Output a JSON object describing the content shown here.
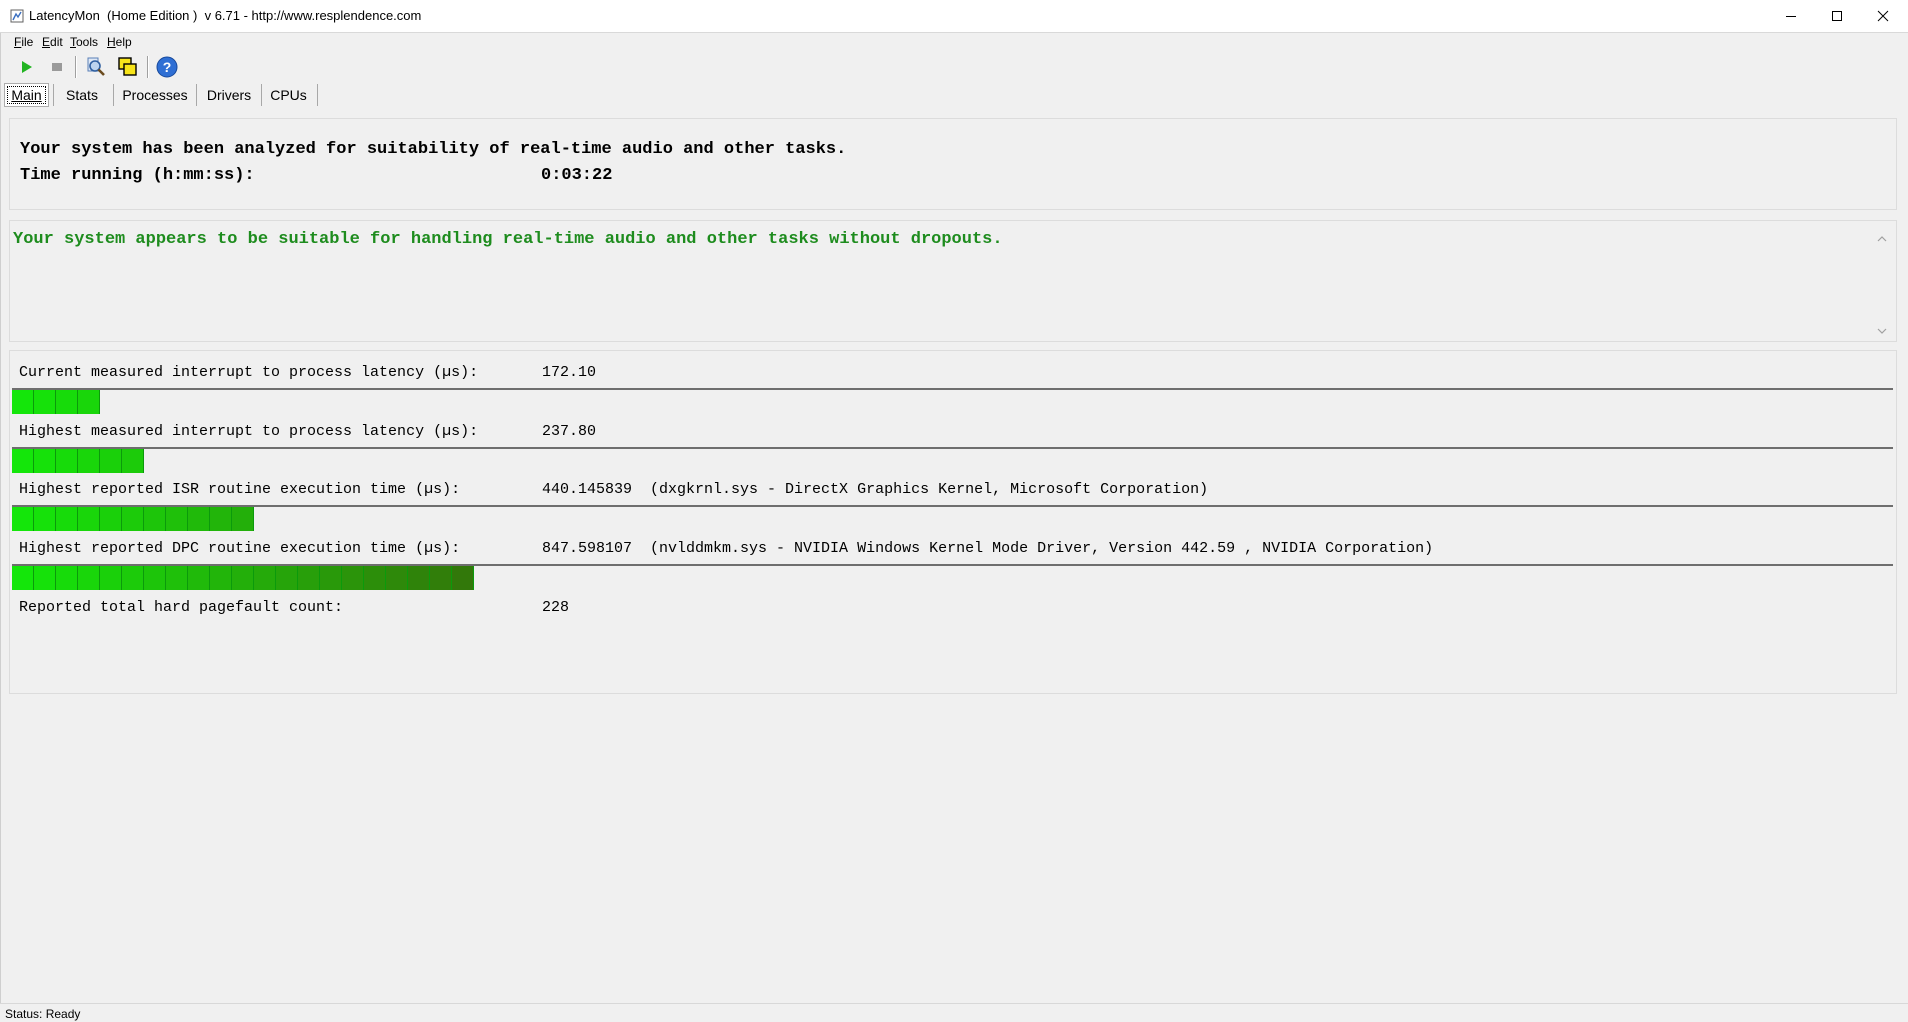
{
  "window": {
    "title": "LatencyMon  (Home Edition )  v 6.71 - http://www.resplendence.com"
  },
  "menu": [
    {
      "label": "File",
      "accel": "F",
      "rest": "ile"
    },
    {
      "label": "Edit",
      "accel": "E",
      "rest": "dit"
    },
    {
      "label": "Tools",
      "accel": "T",
      "rest": "ools"
    },
    {
      "label": "Help",
      "accel": "H",
      "rest": "elp"
    }
  ],
  "toolbar": {
    "icons": [
      "play-icon",
      "stop-icon",
      "search-drivers-icon",
      "windows-icon",
      "help-icon"
    ]
  },
  "tabs": [
    {
      "label": "Main",
      "active": true
    },
    {
      "label": "Stats",
      "active": false
    },
    {
      "label": "Processes",
      "active": false
    },
    {
      "label": "Drivers",
      "active": false
    },
    {
      "label": "CPUs",
      "active": false
    }
  ],
  "summary": {
    "analyzed_text": "Your system has been analyzed for suitability of real-time audio and other tasks.",
    "time_label": "Time running (h:mm:ss):",
    "time_value": "0:03:22"
  },
  "verdict": {
    "text": "Your system appears to be suitable for handling real-time audio and other tasks without dropouts.",
    "color": "#1e8c1e"
  },
  "metrics": [
    {
      "label": "Current measured interrupt to process latency (µs):",
      "value": "172.10",
      "detail": "",
      "bar_segments": 4
    },
    {
      "label": "Highest measured interrupt to process latency (µs):",
      "value": "237.80",
      "detail": "",
      "bar_segments": 6
    },
    {
      "label": "Highest reported ISR routine execution time (µs):",
      "value": "440.145839",
      "detail": "(dxgkrnl.sys - DirectX Graphics Kernel, Microsoft Corporation)",
      "bar_segments": 11
    },
    {
      "label": "Highest reported DPC routine execution time (µs):",
      "value": "847.598107",
      "detail": "(nvlddmkm.sys - NVIDIA Windows Kernel Mode Driver, Version 442.59 , NVIDIA Corporation)",
      "bar_segments": 21
    }
  ],
  "pagefault": {
    "label": "Reported total hard pagefault count:",
    "value": "228"
  },
  "status": {
    "text": "Status: Ready"
  }
}
